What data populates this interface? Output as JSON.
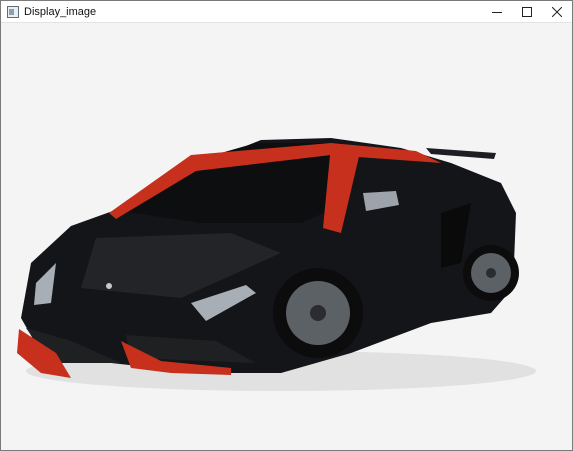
{
  "window": {
    "title": "Display_image",
    "controls": [
      "minimize",
      "maximize",
      "close"
    ]
  },
  "image": {
    "subject": "car-image",
    "colors": {
      "background": "#f4f4f4",
      "body": "#141518",
      "accent": "#c8301e",
      "glass": "#0d0e10"
    }
  }
}
